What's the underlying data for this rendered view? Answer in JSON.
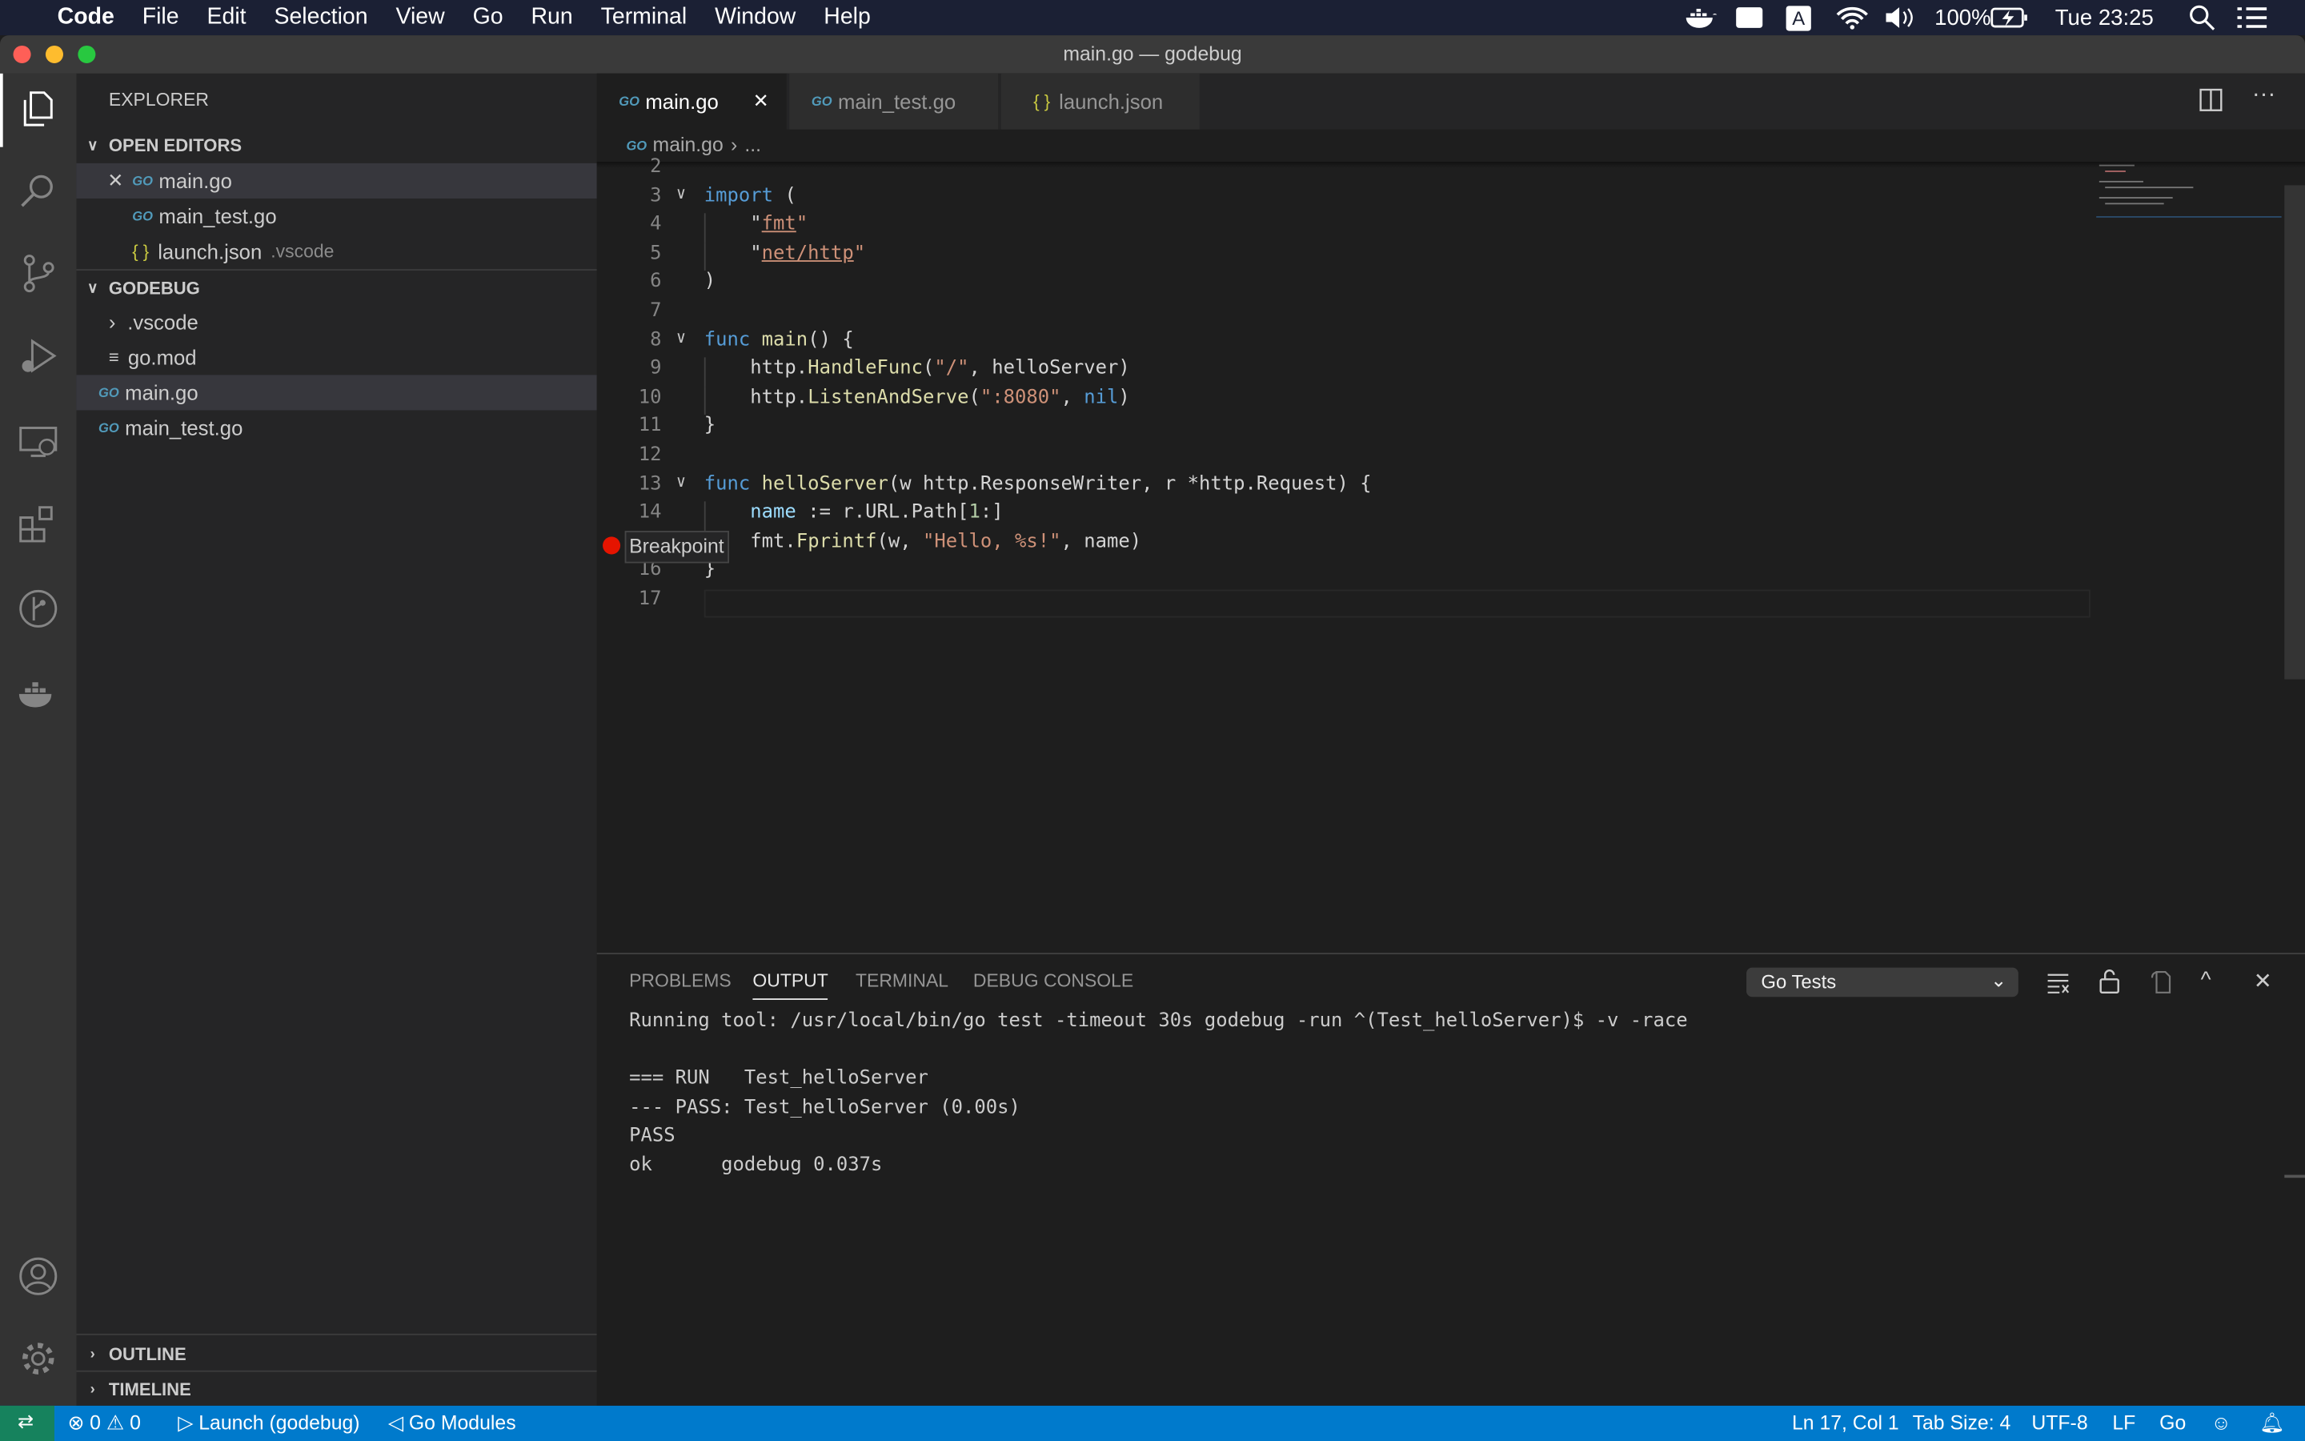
{
  "menubar": {
    "app": "Code",
    "items": [
      "File",
      "Edit",
      "Selection",
      "View",
      "Go",
      "Run",
      "Terminal",
      "Window",
      "Help"
    ],
    "battery": "100%",
    "clock": "Tue 23:25",
    "input_source": "A"
  },
  "window": {
    "title": "main.go — godebug"
  },
  "sidebar": {
    "title": "EXPLORER",
    "open_editors": "OPEN EDITORS",
    "open_files": [
      {
        "name": "main.go",
        "type": "go"
      },
      {
        "name": "main_test.go",
        "type": "go"
      },
      {
        "name": "launch.json",
        "type": "json",
        "hint": ".vscode"
      }
    ],
    "project": "GODEBUG",
    "tree": [
      {
        "name": ".vscode",
        "type": "folder"
      },
      {
        "name": "go.mod",
        "type": "mod"
      },
      {
        "name": "main.go",
        "type": "go"
      },
      {
        "name": "main_test.go",
        "type": "go"
      }
    ],
    "outline": "OUTLINE",
    "timeline": "TIMELINE"
  },
  "tabs": [
    {
      "label": "main.go",
      "type": "go",
      "active": true
    },
    {
      "label": "main_test.go",
      "type": "go"
    },
    {
      "label": "launch.json",
      "type": "json"
    }
  ],
  "breadcrumb": {
    "file": "main.go",
    "rest": "..."
  },
  "editor": {
    "breakpoint_tooltip": "Breakpoint",
    "breakpoint_line": 15,
    "lines": [
      {
        "n": "2",
        "t": []
      },
      {
        "n": "3",
        "fold": true,
        "t": [
          [
            "import",
            "k"
          ],
          [
            " (",
            ""
          ]
        ]
      },
      {
        "n": "4",
        "t": [
          [
            "    \"",
            ""
          ],
          [
            "fmt",
            "s u"
          ],
          [
            "\"",
            "s"
          ]
        ]
      },
      {
        "n": "5",
        "t": [
          [
            "    \"",
            ""
          ],
          [
            "net/http",
            "s u"
          ],
          [
            "\"",
            "s"
          ]
        ]
      },
      {
        "n": "6",
        "t": [
          [
            ")",
            ""
          ]
        ]
      },
      {
        "n": "7",
        "t": []
      },
      {
        "n": "8",
        "fold": true,
        "t": [
          [
            "func",
            "k"
          ],
          [
            " ",
            ""
          ],
          [
            "main",
            "f"
          ],
          [
            "() {",
            ""
          ]
        ]
      },
      {
        "n": "9",
        "t": [
          [
            "    http.",
            ""
          ],
          [
            "HandleFunc",
            "f"
          ],
          [
            "(",
            ""
          ],
          [
            "\"/\"",
            "s"
          ],
          [
            ", helloServer)",
            ""
          ]
        ]
      },
      {
        "n": "10",
        "t": [
          [
            "    http.",
            ""
          ],
          [
            "ListenAndServe",
            "f"
          ],
          [
            "(",
            ""
          ],
          [
            "\":8080\"",
            "s"
          ],
          [
            ", ",
            ""
          ],
          [
            "nil",
            "k"
          ],
          [
            ")",
            ""
          ]
        ]
      },
      {
        "n": "11",
        "t": [
          [
            "}",
            ""
          ]
        ]
      },
      {
        "n": "12",
        "t": []
      },
      {
        "n": "13",
        "fold": true,
        "t": [
          [
            "func",
            "k"
          ],
          [
            " ",
            ""
          ],
          [
            "helloServer",
            "f"
          ],
          [
            "(w http.ResponseWriter, r *http.Request) {",
            ""
          ]
        ]
      },
      {
        "n": "14",
        "t": [
          [
            "    ",
            ""
          ],
          [
            "name",
            "v"
          ],
          [
            " := r.URL.Path[",
            ""
          ],
          [
            "1",
            "n"
          ],
          [
            ":]",
            ""
          ]
        ]
      },
      {
        "n": "15",
        "t": [
          [
            "    fmt.",
            ""
          ],
          [
            "Fprintf",
            "f"
          ],
          [
            "(w, ",
            ""
          ],
          [
            "\"Hello, %s!\"",
            "s"
          ],
          [
            ", name)",
            ""
          ]
        ]
      },
      {
        "n": "16",
        "t": [
          [
            "}",
            ""
          ]
        ]
      },
      {
        "n": "17",
        "t": []
      }
    ]
  },
  "panel": {
    "tabs": [
      "PROBLEMS",
      "OUTPUT",
      "TERMINAL",
      "DEBUG CONSOLE"
    ],
    "active_tab": "OUTPUT",
    "channel": "Go Tests",
    "output": [
      "Running tool: /usr/local/bin/go test -timeout 30s godebug -run ^(Test_helloServer)$ -v -race",
      "",
      "=== RUN   Test_helloServer",
      "--- PASS: Test_helloServer (0.00s)",
      "PASS",
      "ok      godebug 0.037s"
    ]
  },
  "status": {
    "errors": "0",
    "warnings": "0",
    "launch": "Launch (godebug)",
    "modules": "Go Modules",
    "position": "Ln 17, Col 1",
    "tab_size": "Tab Size: 4",
    "encoding": "UTF-8",
    "eol": "LF",
    "language": "Go"
  },
  "colors": {
    "status_bar": "#007acc",
    "remote": "#16825d",
    "breakpoint": "#e51400",
    "accent": "#007acc"
  }
}
